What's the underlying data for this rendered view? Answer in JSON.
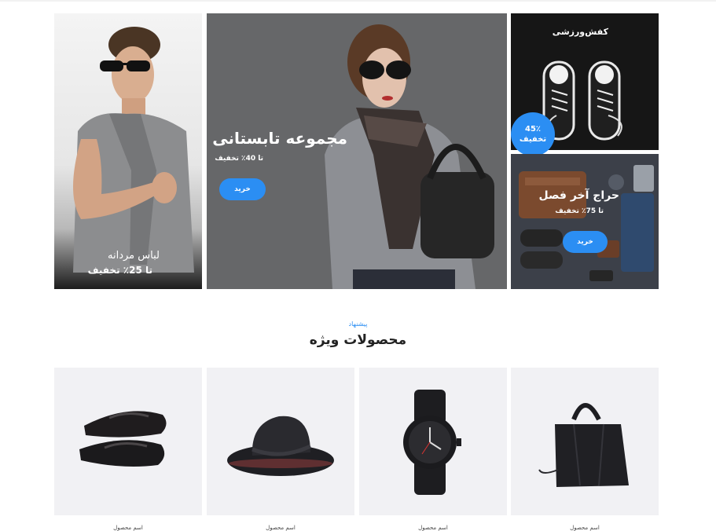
{
  "banners": {
    "men": {
      "title": "لباس مردانه",
      "discount": "تا 25٪ تخفیف"
    },
    "summer": {
      "title": "مجموعه تابستانی",
      "discount": "تا 40٪ تخفیف",
      "button": "خرید"
    },
    "sport": {
      "title": "کفش‌ورزشی",
      "badge_value": "45٪",
      "badge_text": "تخفیف"
    },
    "sale": {
      "title": "حراج آخر فصل",
      "discount": "تا 75٪ تخفیف",
      "button": "خرید"
    }
  },
  "featured": {
    "eyebrow": "پیشنهاد",
    "title": "محصولات ویژه",
    "products": [
      {
        "name": "اسم محصول",
        "icon": "handbag-icon"
      },
      {
        "name": "اسم محصول",
        "icon": "watch-icon"
      },
      {
        "name": "اسم محصول",
        "icon": "hat-icon"
      },
      {
        "name": "اسم محصول",
        "icon": "slippers-icon"
      }
    ]
  },
  "colors": {
    "accent": "#2b8ef3",
    "card_bg": "#f1f1f4"
  }
}
